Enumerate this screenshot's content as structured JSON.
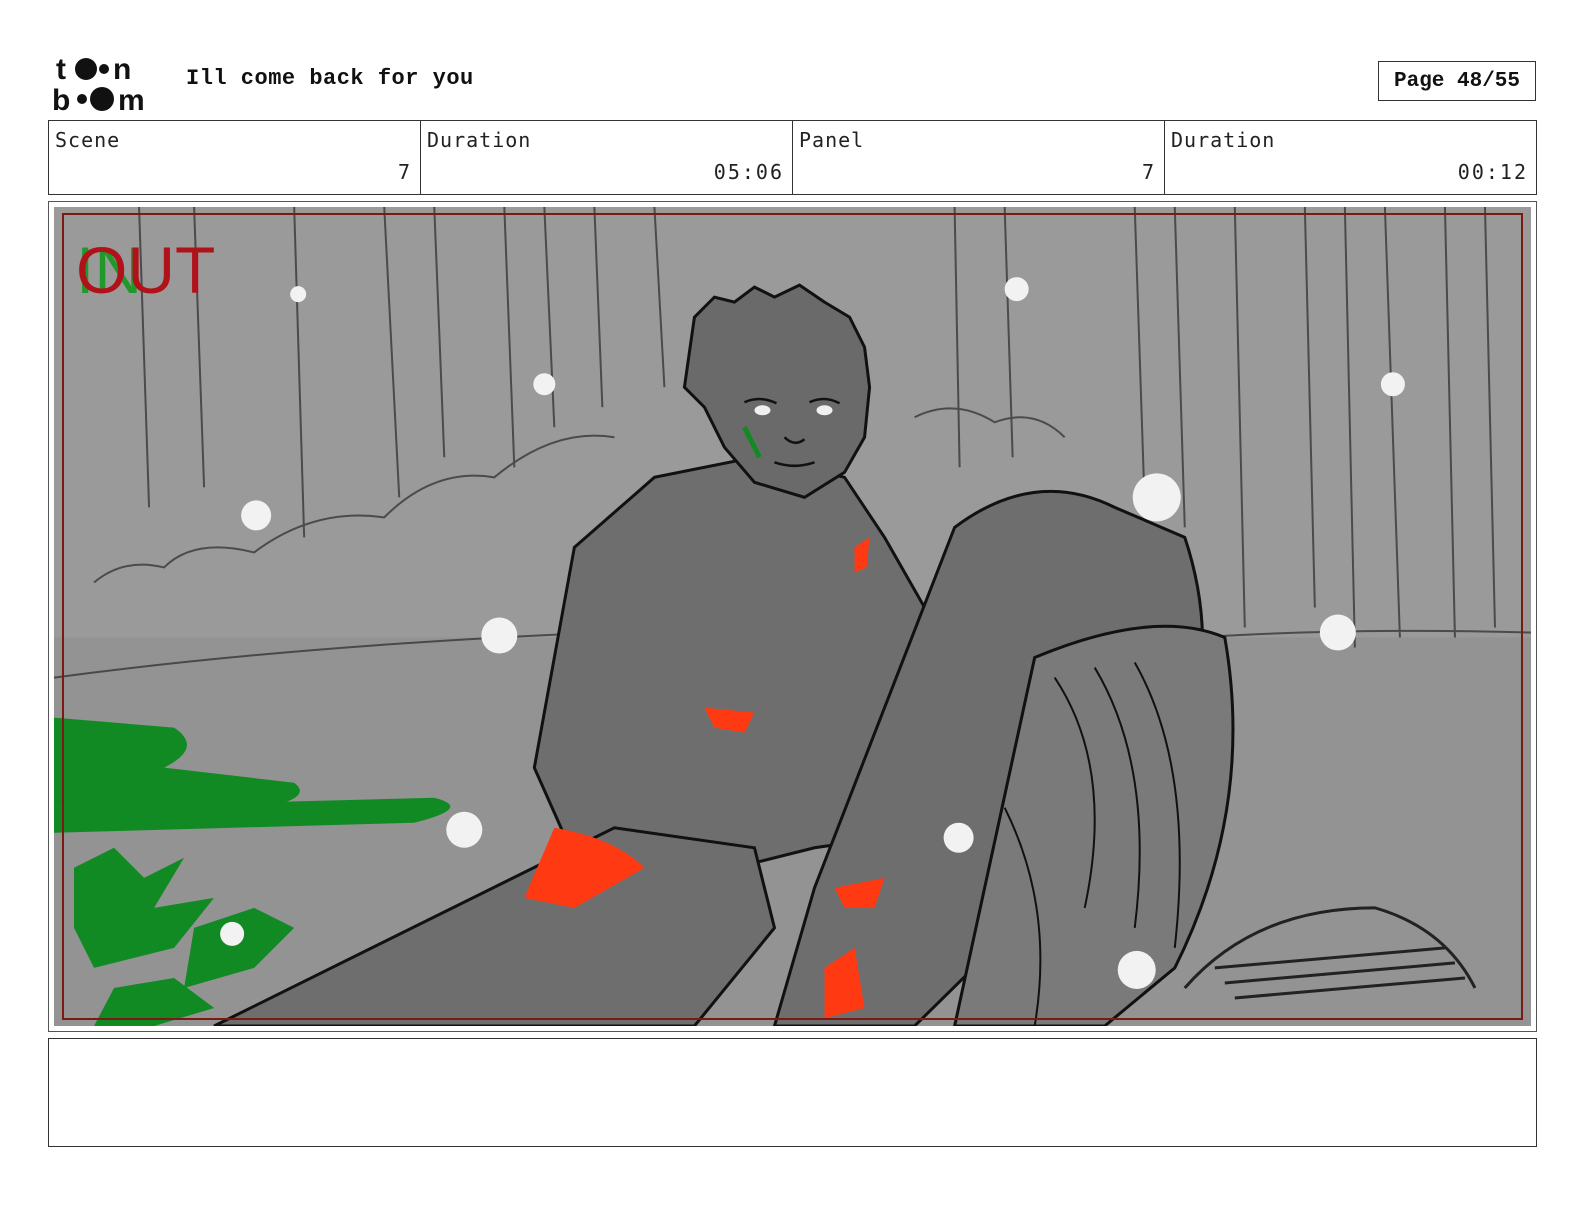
{
  "header": {
    "logo_text_top": "toon",
    "logo_text_bottom": "boom",
    "title": "Ill come back for you",
    "page_label": "Page 48/55"
  },
  "info": [
    {
      "label": "Scene",
      "value": "7"
    },
    {
      "label": "Duration",
      "value": "05:06"
    },
    {
      "label": "Panel",
      "value": "7"
    },
    {
      "label": "Duration",
      "value": "00:12"
    }
  ],
  "panel": {
    "in_marker": "IN",
    "out_marker": "OUT",
    "colors": {
      "background": "#9a9a9a",
      "in": "#1f9a2a",
      "out": "#b0121a",
      "blood": "#ff3a12",
      "grass": "#128a24",
      "snow": "#f2f2f2"
    }
  },
  "notes": {
    "text": ""
  }
}
